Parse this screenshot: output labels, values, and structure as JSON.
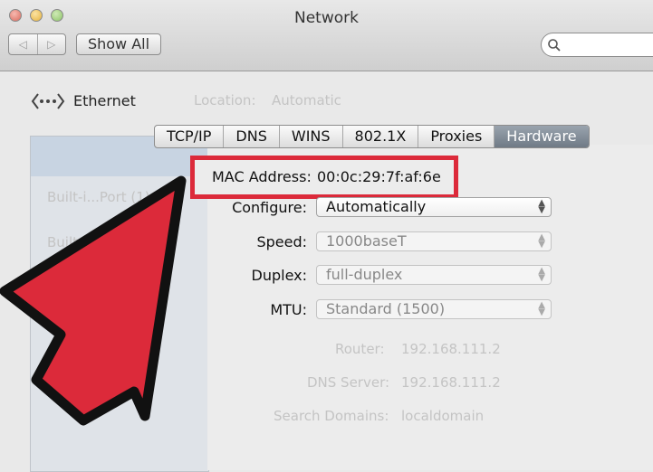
{
  "window": {
    "title": "Network"
  },
  "toolbar": {
    "back_icon": "◁",
    "forward_icon": "▷",
    "show_all": "Show All",
    "search_placeholder": ""
  },
  "service": {
    "name": "Ethernet"
  },
  "background": {
    "location_label": "Location:",
    "location_value": "Automatic",
    "sidebar_items": [
      "Built-i...Port (1)",
      "Built-i..."
    ],
    "router_label": "Router:",
    "router_value": "192.168.111.2",
    "dns_label": "DNS Server:",
    "dns_value": "192.168.111.2",
    "search_domains_label": "Search Domains:",
    "search_domains_value": "localdomain"
  },
  "tabs": [
    "TCP/IP",
    "DNS",
    "WINS",
    "802.1X",
    "Proxies",
    "Hardware"
  ],
  "active_tab": "Hardware",
  "hardware": {
    "mac_label": "MAC Address:",
    "mac_value": "00:0c:29:7f:af:6e",
    "configure_label": "Configure:",
    "configure_value": "Automatically",
    "speed_label": "Speed:",
    "speed_value": "1000baseT",
    "duplex_label": "Duplex:",
    "duplex_value": "full-duplex",
    "mtu_label": "MTU:",
    "mtu_value": "Standard  (1500)"
  },
  "colors": {
    "highlight": "#dc2a3a",
    "arrow_fill": "#dc2a3a",
    "active_tab": "#7a8591"
  }
}
